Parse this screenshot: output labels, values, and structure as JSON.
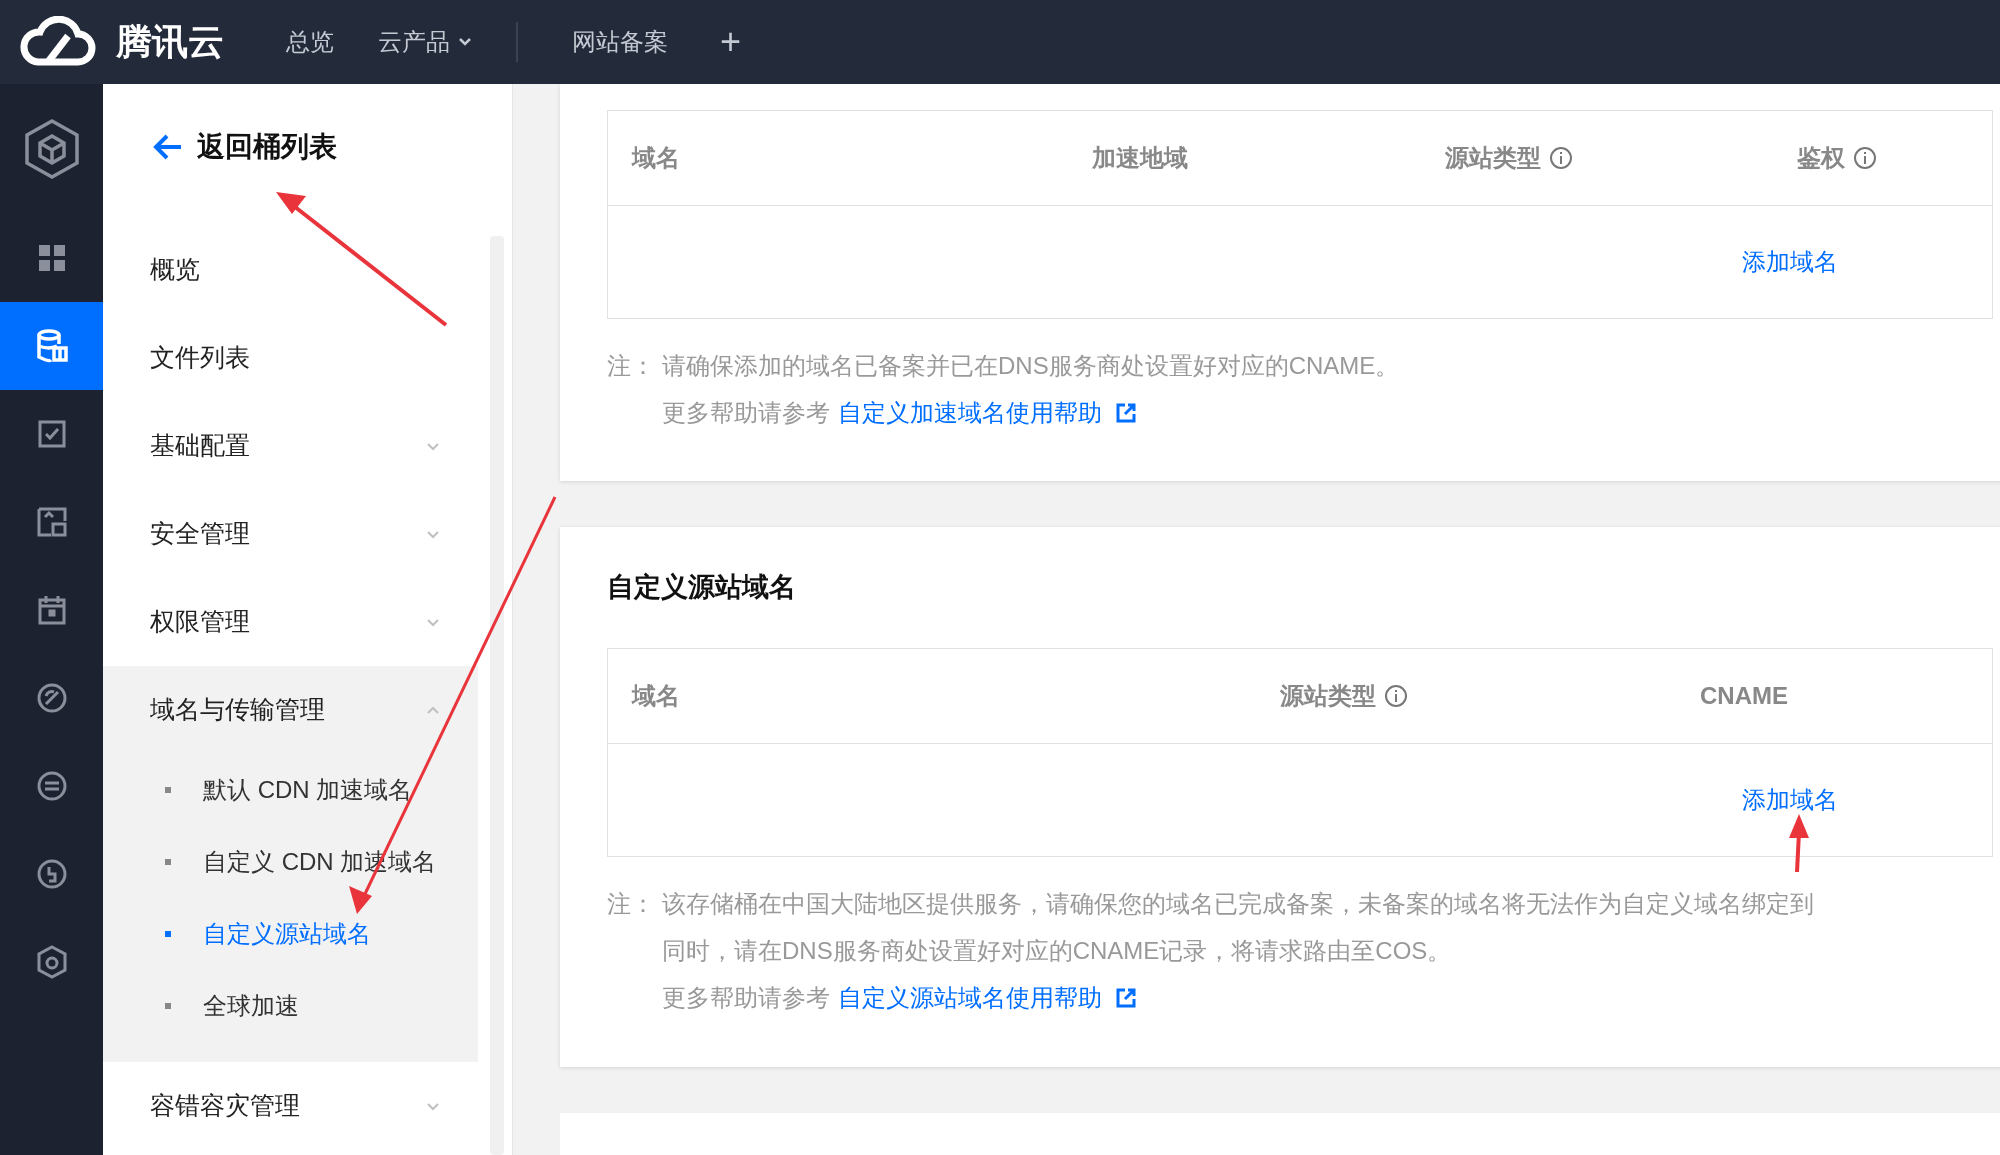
{
  "top_nav": {
    "brand": "腾讯云",
    "items": [
      {
        "label": "总览",
        "dropdown": false
      },
      {
        "label": "云产品",
        "dropdown": true
      },
      {
        "label": "网站备案",
        "dropdown": false
      }
    ],
    "add": "+"
  },
  "rail": {
    "items": [
      {
        "kind": "logo",
        "selected": false
      },
      {
        "kind": "grid",
        "selected": false
      },
      {
        "kind": "database",
        "selected": true
      },
      {
        "kind": "check",
        "selected": false
      },
      {
        "kind": "image",
        "selected": false
      },
      {
        "kind": "calendar",
        "selected": false
      },
      {
        "kind": "gauge",
        "selected": false
      },
      {
        "kind": "swap",
        "selected": false
      },
      {
        "kind": "coin",
        "selected": false
      },
      {
        "kind": "hub",
        "selected": false
      }
    ]
  },
  "sidebar": {
    "back": "返回桶列表",
    "items": [
      {
        "label": "概览"
      },
      {
        "label": "文件列表"
      },
      {
        "label": "基础配置",
        "expanded": false
      },
      {
        "label": "安全管理",
        "expanded": false
      },
      {
        "label": "权限管理",
        "expanded": false
      },
      {
        "label": "域名与传输管理",
        "expanded": true,
        "children": [
          {
            "label": "默认 CDN 加速域名",
            "selected": false
          },
          {
            "label": "自定义 CDN 加速域名",
            "selected": false
          },
          {
            "label": "自定义源站域名",
            "selected": true
          },
          {
            "label": "全球加速",
            "selected": false
          }
        ]
      },
      {
        "label": "容错容灾管理",
        "expanded": false
      }
    ]
  },
  "sections": [
    {
      "columns": [
        {
          "label": "域名",
          "info": false
        },
        {
          "label": "加速地域",
          "info": false
        },
        {
          "label": "源站类型",
          "info": true
        },
        {
          "label": "鉴权",
          "info": true
        }
      ],
      "action": "添加域名",
      "note_label": "注：",
      "note_lines": [
        "请确保添加的域名已备案并已在DNS服务商处设置好对应的CNAME。"
      ],
      "help_prefix": "更多帮助请参考",
      "help_link": "自定义加速域名使用帮助"
    },
    {
      "title": "自定义源站域名",
      "columns": [
        {
          "label": "域名",
          "info": false
        },
        {
          "label": "源站类型",
          "info": true
        },
        {
          "label": "CNAME",
          "info": false
        }
      ],
      "action": "添加域名",
      "note_label": "注：",
      "note_lines": [
        "该存储桶在中国大陆地区提供服务，请确保您的域名已完成备案，未备案的域名将无法作为自定义域名绑定到",
        "同时，请在DNS服务商处设置好对应的CNAME记录，将请求路由至COS。"
      ],
      "help_prefix": "更多帮助请参考",
      "help_link": "自定义源站域名使用帮助"
    }
  ]
}
